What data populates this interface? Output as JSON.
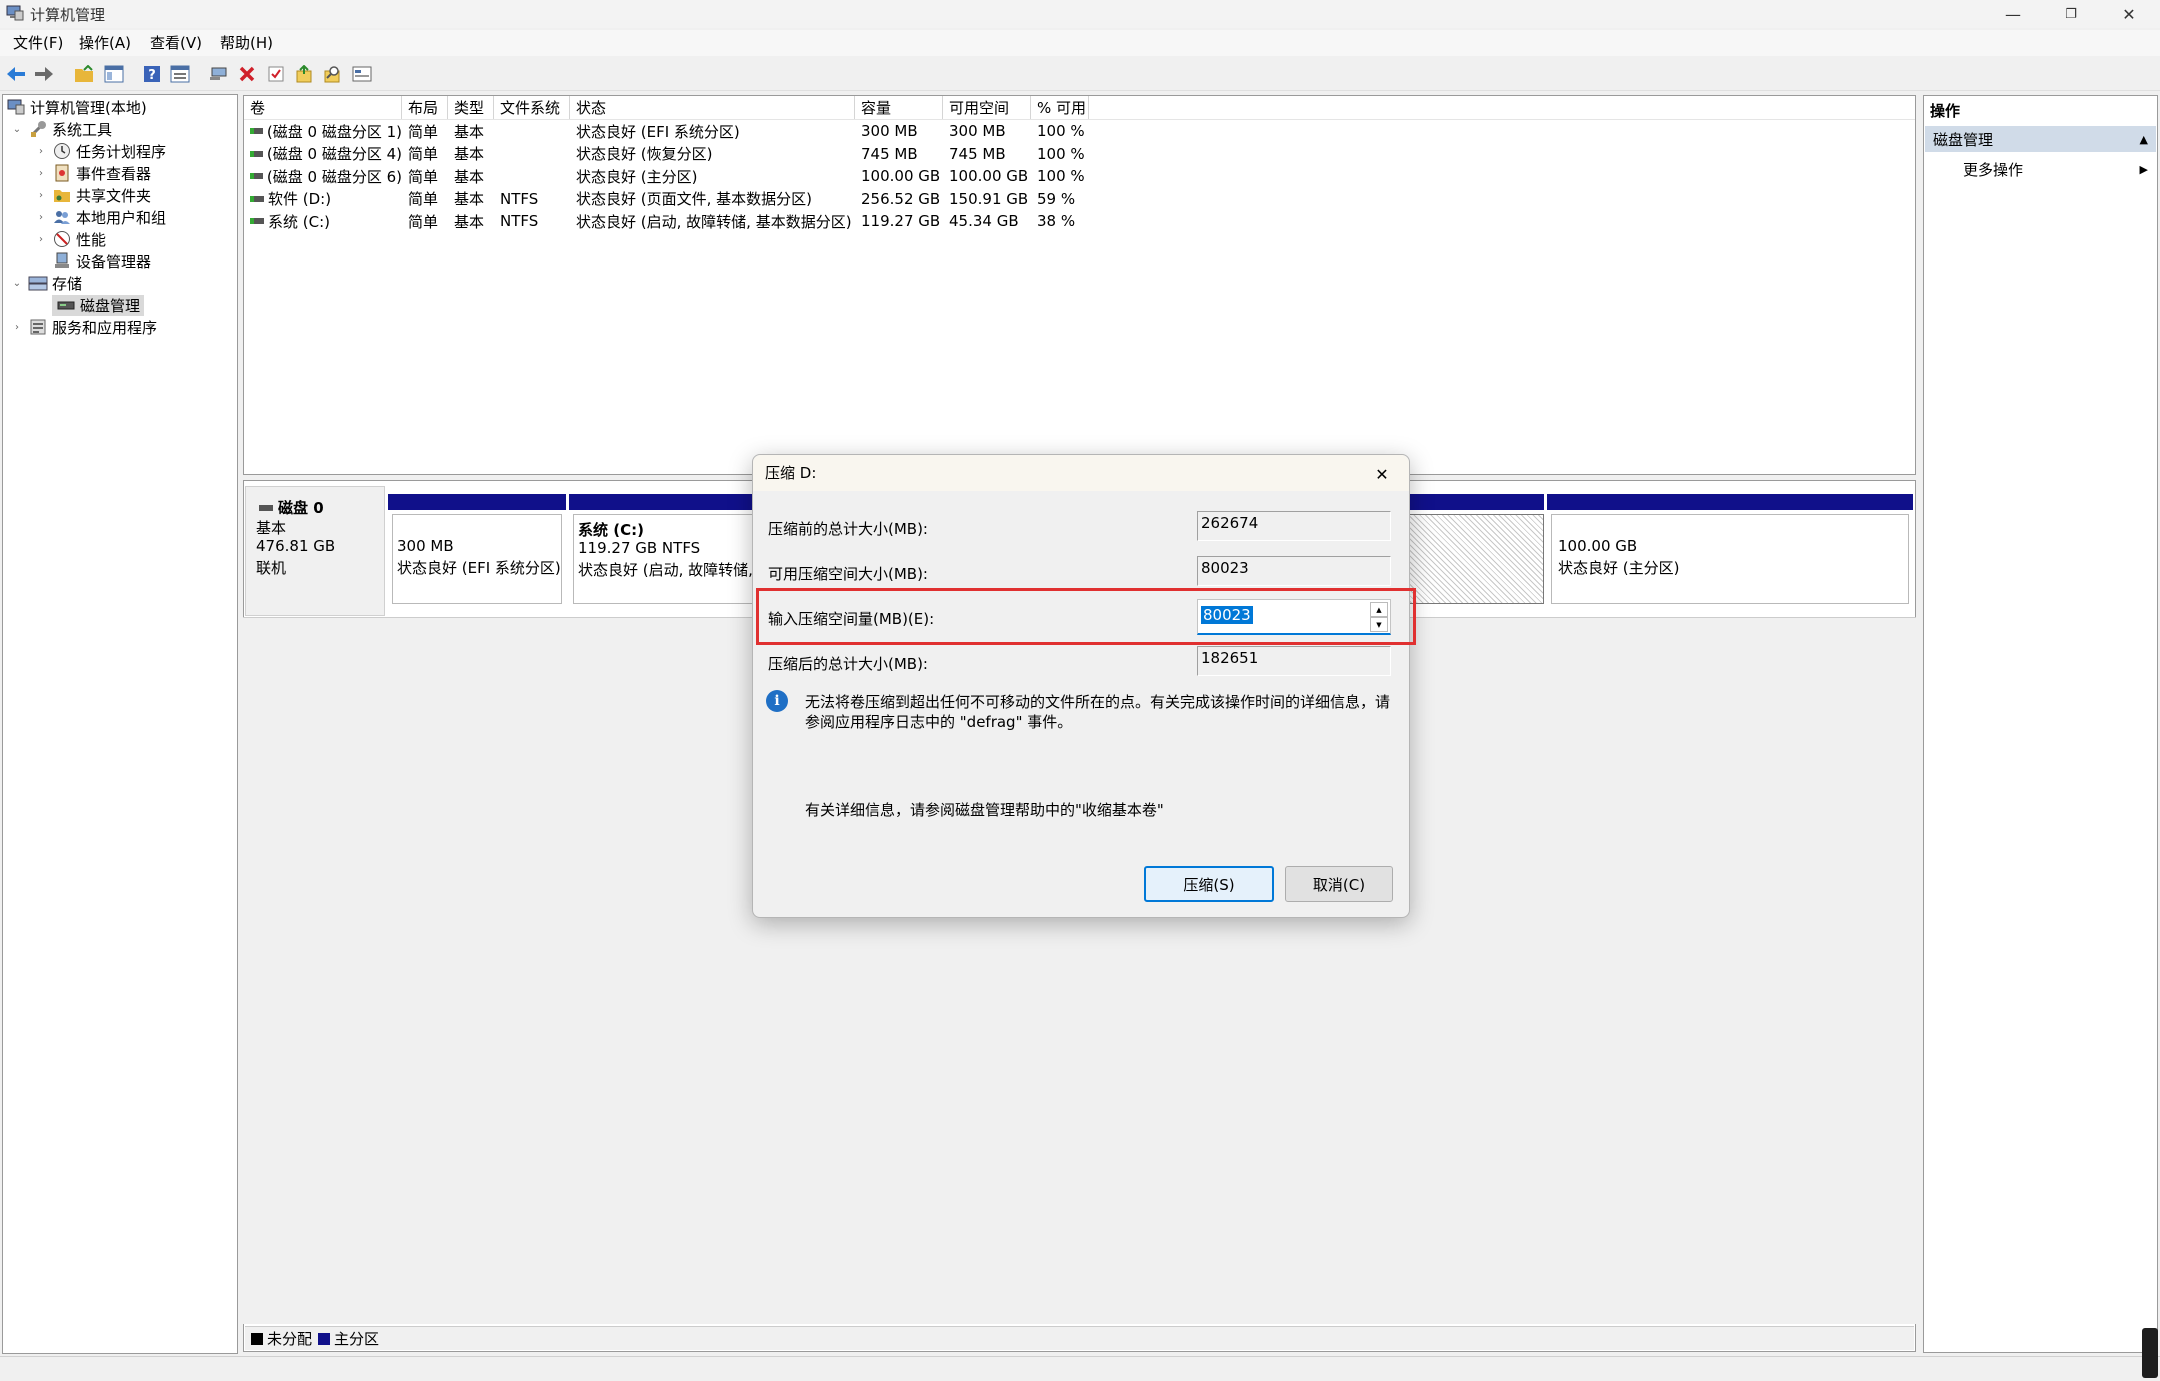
{
  "window": {
    "title": "计算机管理",
    "controls": {
      "minimize": "—",
      "restore": "❐",
      "close": "✕"
    }
  },
  "menu": [
    "文件(F)",
    "操作(A)",
    "查看(V)",
    "帮助(H)"
  ],
  "toolbar_icons": [
    "back-arrow-icon",
    "forward-arrow-icon",
    "up-folder-icon",
    "show-hide-tree-icon",
    "help-icon",
    "properties-icon",
    "connect-icon",
    "delete-icon",
    "check-icon",
    "import-icon",
    "search-icon",
    "view-icon"
  ],
  "tree": {
    "root": "计算机管理(本地)",
    "system_tools": "系统工具",
    "task_scheduler": "任务计划程序",
    "event_viewer": "事件查看器",
    "shared_folders": "共享文件夹",
    "local_users": "本地用户和组",
    "performance": "性能",
    "device_manager": "设备管理器",
    "storage": "存储",
    "disk_management": "磁盘管理",
    "services_apps": "服务和应用程序"
  },
  "volume_list": {
    "columns": [
      "卷",
      "布局",
      "类型",
      "文件系统",
      "状态",
      "容量",
      "可用空间",
      "% 可用"
    ],
    "rows": [
      [
        "(磁盘 0 磁盘分区 1)",
        "简单",
        "基本",
        "",
        "状态良好 (EFI 系统分区)",
        "300 MB",
        "300 MB",
        "100 %"
      ],
      [
        "(磁盘 0 磁盘分区 4)",
        "简单",
        "基本",
        "",
        "状态良好 (恢复分区)",
        "745 MB",
        "745 MB",
        "100 %"
      ],
      [
        "(磁盘 0 磁盘分区 6)",
        "简单",
        "基本",
        "",
        "状态良好 (主分区)",
        "100.00 GB",
        "100.00 GB",
        "100 %"
      ],
      [
        "软件 (D:)",
        "简单",
        "基本",
        "NTFS",
        "状态良好 (页面文件, 基本数据分区)",
        "256.52 GB",
        "150.91 GB",
        "59 %"
      ],
      [
        "系统 (C:)",
        "简单",
        "基本",
        "NTFS",
        "状态良好 (启动, 故障转储, 基本数据分区)",
        "119.27 GB",
        "45.34 GB",
        "38 %"
      ]
    ]
  },
  "disk0": {
    "name": "磁盘 0",
    "type": "基本",
    "size": "476.81 GB",
    "status": "联机",
    "partitions": {
      "efi": {
        "size": "300 MB",
        "status": "状态良好 (EFI 系统分区)"
      },
      "c": {
        "name": "系统 (C:)",
        "size": "119.27 GB NTFS",
        "status": "状态良好 (启动, 故障转储,"
      },
      "last": {
        "size": "100.00 GB",
        "status": "状态良好 (主分区)"
      }
    }
  },
  "legend": {
    "unallocated": "未分配",
    "primary": "主分区"
  },
  "actions": {
    "header": "操作",
    "section": "磁盘管理",
    "more": "更多操作"
  },
  "dialog": {
    "title": "压缩 D:",
    "total_before_label": "压缩前的总计大小(MB):",
    "total_before_value": "262674",
    "available_label": "可用压缩空间大小(MB):",
    "available_value": "80023",
    "input_label": "输入压缩空间量(MB)(E):",
    "input_value": "80023",
    "total_after_label": "压缩后的总计大小(MB):",
    "total_after_value": "182651",
    "info_text_1": "无法将卷压缩到超出任何不可移动的文件所在的点。有关完成该操作时间的详细信息，请",
    "info_text_2": "参阅应用程序日志中的 \"defrag\" 事件。",
    "help_text": "有关详细信息，请参阅磁盘管理帮助中的\"收缩基本卷\"",
    "ok_label": "压缩(S)",
    "cancel_label": "取消(C)",
    "close": "✕"
  },
  "colors": {
    "primary_partition": "#10108a",
    "highlight_red": "#e03030",
    "selection_blue": "#0078d7"
  }
}
